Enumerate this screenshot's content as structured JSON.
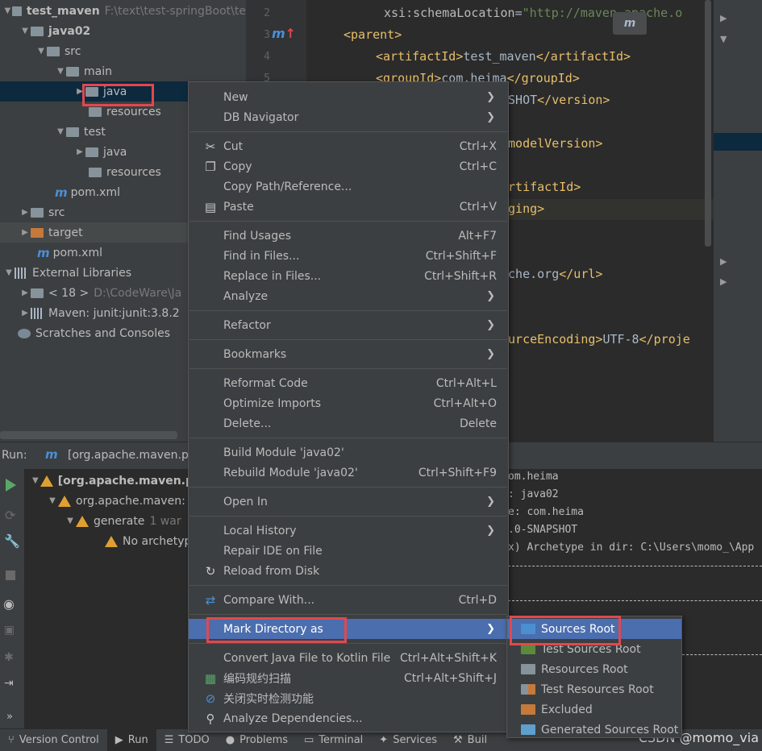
{
  "project_tree": {
    "root_name": "test_maven",
    "root_path": "F:\\text\\test-springBoot\\te",
    "items": [
      {
        "label": "java02"
      },
      {
        "label": "src"
      },
      {
        "label": "main"
      },
      {
        "label": "java"
      },
      {
        "label": "resources"
      },
      {
        "label": "test"
      },
      {
        "label": "java"
      },
      {
        "label": "resources"
      },
      {
        "label": "pom.xml"
      },
      {
        "label": "src"
      },
      {
        "label": "target"
      },
      {
        "label": "pom.xml"
      },
      {
        "label": "External Libraries"
      },
      {
        "label": "< 18 >",
        "extra": "D:\\CodeWare\\Ja"
      },
      {
        "label": "Maven: junit:junit:3.8.2"
      },
      {
        "label": "Scratches and Consoles"
      }
    ]
  },
  "editor": {
    "line_numbers": [
      "2",
      "3",
      "4",
      "5"
    ],
    "lines": [
      {
        "attr": "xsi",
        "colon": ":",
        "name": "schemaLocation",
        "eq": "=",
        "val": "\"http://maven.apache.o"
      },
      {
        "text": "<parent>"
      },
      {
        "text": "<artifactId>",
        "inner": "test_maven",
        "close": "</artifactId>"
      },
      {
        "text": "<groupId>",
        "inner": "com.heima",
        "close": "</groupId>"
      },
      {
        "inner": "PSHOT",
        "close": "</version>"
      },
      {
        "close": "/modelVersion>"
      },
      {
        "close": "artifactId>"
      },
      {
        "close": "aging>"
      },
      {
        "inner": "ache.org",
        "close": "</url>"
      },
      {
        "close": "ourceEncoding>",
        "inner": "UTF-8",
        "close2": "</proje"
      }
    ]
  },
  "run_panel": {
    "label": "Run:",
    "tab": "[org.apache.maven.plu",
    "tree": [
      {
        "label": "[org.apache.maven.p"
      },
      {
        "label": "org.apache.maven:"
      },
      {
        "label": "generate",
        "extra": "1 war"
      },
      {
        "label": "No archetyp"
      }
    ],
    "console": [
      "om.heima",
      ": java02",
      "e: com.heima",
      ".0-SNAPSHOT",
      "x) Archetype in dir: C:\\Users\\momo_\\App"
    ]
  },
  "context_menu": {
    "items": [
      {
        "label": "New",
        "sub": true
      },
      {
        "label": "DB Navigator",
        "sub": true
      },
      {
        "label": "Cut",
        "shortcut": "Ctrl+X",
        "icon": "scissors-icon"
      },
      {
        "label": "Copy",
        "shortcut": "Ctrl+C",
        "icon": "copy-icon"
      },
      {
        "label": "Copy Path/Reference..."
      },
      {
        "label": "Paste",
        "shortcut": "Ctrl+V",
        "icon": "paste-icon"
      },
      {
        "label": "Find Usages",
        "shortcut": "Alt+F7"
      },
      {
        "label": "Find in Files...",
        "shortcut": "Ctrl+Shift+F"
      },
      {
        "label": "Replace in Files...",
        "shortcut": "Ctrl+Shift+R"
      },
      {
        "label": "Analyze",
        "sub": true
      },
      {
        "label": "Refactor",
        "sub": true
      },
      {
        "label": "Bookmarks",
        "sub": true
      },
      {
        "label": "Reformat Code",
        "shortcut": "Ctrl+Alt+L"
      },
      {
        "label": "Optimize Imports",
        "shortcut": "Ctrl+Alt+O"
      },
      {
        "label": "Delete...",
        "shortcut": "Delete"
      },
      {
        "label": "Build Module 'java02'"
      },
      {
        "label": "Rebuild Module 'java02'",
        "shortcut": "Ctrl+Shift+F9"
      },
      {
        "label": "Open In",
        "sub": true
      },
      {
        "label": "Local History",
        "sub": true
      },
      {
        "label": "Repair IDE on File"
      },
      {
        "label": "Reload from Disk",
        "icon": "reload-icon"
      },
      {
        "label": "Compare With...",
        "shortcut": "Ctrl+D",
        "icon": "compare-icon"
      },
      {
        "label": "Mark Directory as",
        "sub": true
      },
      {
        "label": "Convert Java File to Kotlin File",
        "shortcut": "Ctrl+Alt+Shift+K"
      },
      {
        "label": "编码规约扫描",
        "shortcut": "Ctrl+Alt+Shift+J",
        "icon": "scan-icon"
      },
      {
        "label": "关闭实时检测功能",
        "icon": "stop-icon"
      },
      {
        "label": "Analyze Dependencies...",
        "icon": "dependencies-icon"
      }
    ]
  },
  "submenu": {
    "items": [
      {
        "label": "Sources Root",
        "color": "#4b8fd1"
      },
      {
        "label": "Test Sources Root",
        "color": "#5b8a3c"
      },
      {
        "label": "Resources Root",
        "color": "#87939a"
      },
      {
        "label": "Test Resources Root",
        "color": "#c5793a"
      },
      {
        "label": "Excluded",
        "color": "#c5793a"
      },
      {
        "label": "Generated Sources Root",
        "color": "#5e9fcb"
      }
    ]
  },
  "bottom_bar": {
    "tabs": [
      "Version Control",
      "Run",
      "TODO",
      "Problems",
      "Terminal",
      "Services",
      "Buil"
    ]
  },
  "watermark": "CSDN @momo_via",
  "colors": {
    "accent": "#4b6eaf",
    "highlight_box": "#e0484e"
  }
}
